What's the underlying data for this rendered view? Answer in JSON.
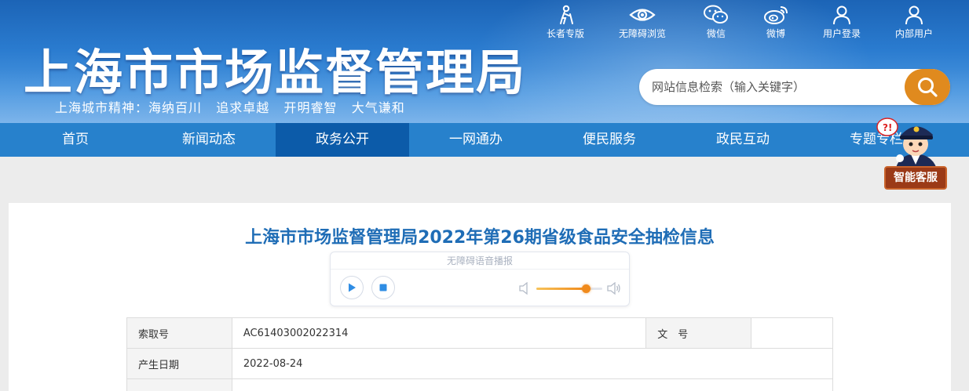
{
  "header": {
    "site_title": "上海市市场监督管理局",
    "motto": "上海城市精神：海纳百川   追求卓越   开明睿智   大气谦和",
    "tools": [
      {
        "label": "长者专版",
        "icon": "elder-icon"
      },
      {
        "label": "无障碍浏览",
        "icon": "eye-icon"
      },
      {
        "label": "微信",
        "icon": "wechat-icon"
      },
      {
        "label": "微博",
        "icon": "weibo-icon"
      },
      {
        "label": "用户登录",
        "icon": "user-icon"
      },
      {
        "label": "内部用户",
        "icon": "internal-user-icon"
      }
    ]
  },
  "search": {
    "placeholder": "网站信息检索（输入关键字）",
    "button_icon": "search-icon"
  },
  "nav": {
    "items": [
      {
        "label": "首页"
      },
      {
        "label": "新闻动态"
      },
      {
        "label": "政务公开",
        "active": true
      },
      {
        "label": "一网通办"
      },
      {
        "label": "便民服务"
      },
      {
        "label": "政民互动"
      },
      {
        "label": "专题专栏"
      }
    ]
  },
  "mascot": {
    "label": "智能客服"
  },
  "article": {
    "title": "上海市市场监督管理局2022年第26期省级食品安全抽检信息"
  },
  "player": {
    "title": "无障碍语音播报",
    "volume_level": 0.75
  },
  "info_table": {
    "rows": [
      {
        "k1": "索取号",
        "v1": "AC61403002022314",
        "k2": "文　号",
        "v2": ""
      },
      {
        "k1": "产生日期",
        "v1": "2022-08-24"
      }
    ]
  },
  "colors": {
    "header_blue": "#2a7bcf",
    "nav_blue": "#2781cc",
    "nav_active": "#0c5ba9",
    "accent_orange": "#e08a1e",
    "title_blue": "#1f6db6"
  }
}
